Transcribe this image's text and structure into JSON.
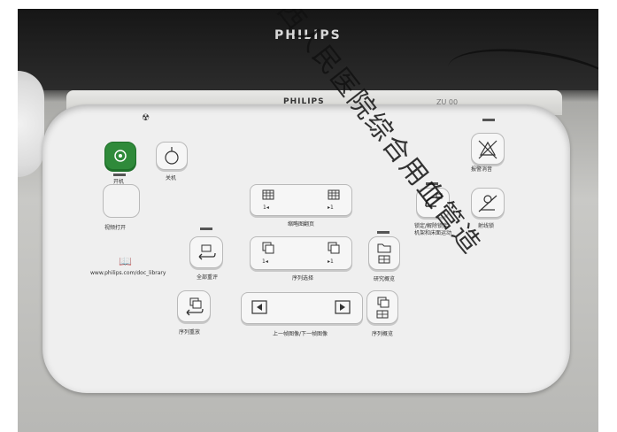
{
  "photo": {
    "monitor_brand": "PHILIPS",
    "base_brand": "PHILIPS",
    "base_model_text": "ZU 00"
  },
  "panel": {
    "power_on_label": "开机",
    "power_off_label": "关机",
    "backlight_label": "视频打开",
    "thumbnail_page_label": "缩略图翻页",
    "all_rewind_label": "全部重评",
    "series_select_label": "序列选择",
    "study_overview_label": "研究概览",
    "series_review_label": "序列重放",
    "prev_next_image_label": "上一帧图像/下一帧图像",
    "series_overview_label": "序列概览",
    "lock_unlock_label_line1": "锁定/解除锁定",
    "lock_unlock_label_line2": "机架和床面运动",
    "mute_label": "射线锁",
    "alarm_label": "报警消音",
    "url": "www.philips.com/doc_library",
    "thumb_left_digit": "1◂",
    "thumb_right_digit": "▸1",
    "series_left_digit": "1◂",
    "series_right_digit": "▸1"
  },
  "watermark": "西人民医院综合用血管造"
}
